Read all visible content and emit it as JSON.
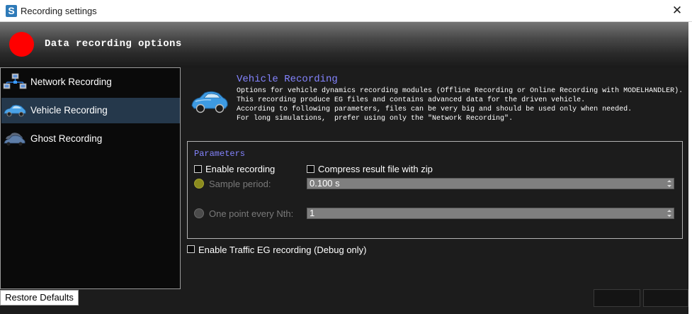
{
  "window": {
    "title": "Recording settings",
    "close_glyph": "✕",
    "app_icon": {
      "name": "app-logo-icon",
      "glyph": "S"
    }
  },
  "header": {
    "title": "Data recording options",
    "indicator_color": "#ff0000"
  },
  "nav": {
    "items": [
      {
        "label": "Network Recording",
        "icon": "network-icon",
        "selected": false
      },
      {
        "label": "Vehicle Recording",
        "icon": "car-icon",
        "selected": true
      },
      {
        "label": "Ghost Recording",
        "icon": "ghost-car-icon",
        "selected": false
      }
    ],
    "selected_color": "#25384b"
  },
  "footer": {
    "restore_label": "Restore Defaults"
  },
  "vehicle": {
    "title": "Vehicle Recording",
    "description": [
      "Options for vehicle dynamics recording modules (Offline Recording or Online Recording with MODELHANDLER).",
      "This recording produce EG files and contains advanced data for the driven vehicle.",
      "According to following parameters, files can be very big and should be used only when needed.",
      "For long simulations,  prefer using only the \"Network Recording\"."
    ]
  },
  "parameters": {
    "legend": "Parameters",
    "enable_recording": {
      "label": "Enable  recording",
      "checked": false
    },
    "compress": {
      "label": "Compress result file with zip",
      "checked": false
    },
    "sample_period": {
      "label": "Sample period:",
      "value": "0.100 s",
      "selected": true
    },
    "one_point_every": {
      "label": "One point every Nth:",
      "value": "1",
      "selected": false
    }
  },
  "traffic": {
    "label": "Enable Traffic EG recording (Debug only)",
    "checked": false
  },
  "colors": {
    "accent_text": "#8484ff",
    "panel_bg": "#1c1c1c"
  }
}
